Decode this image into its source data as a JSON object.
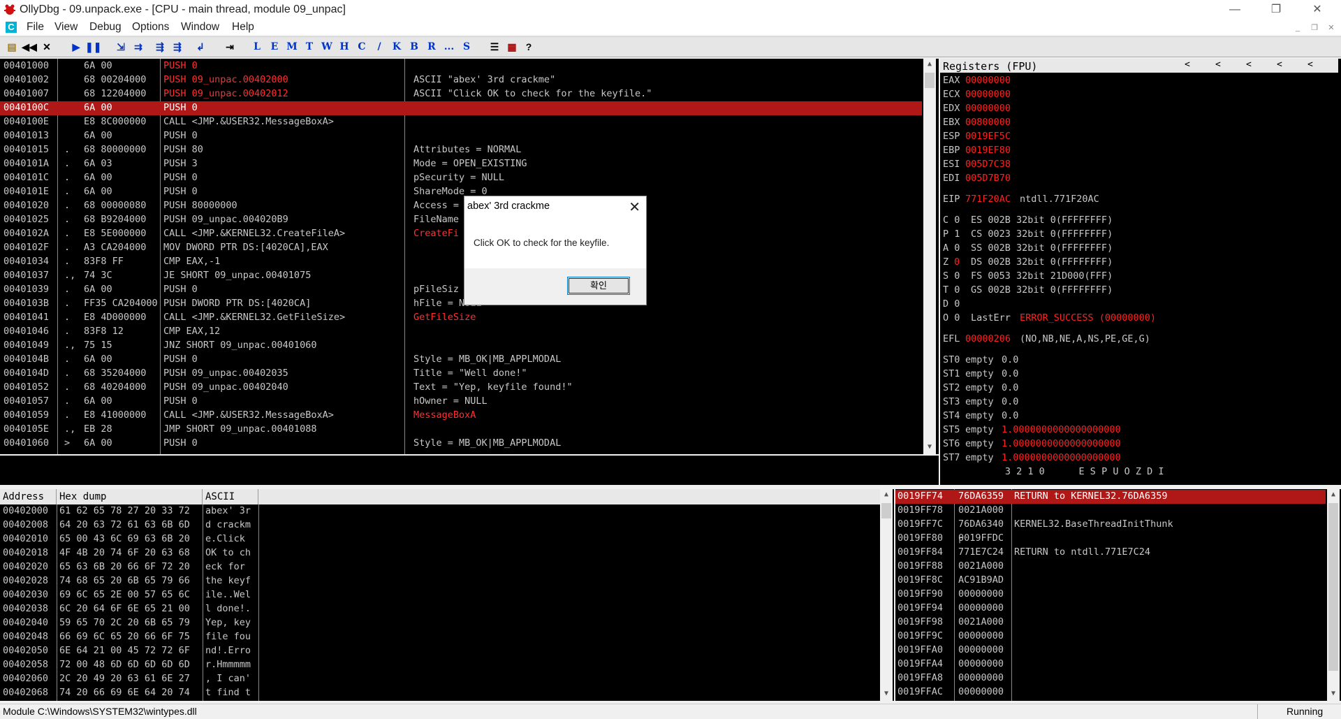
{
  "window": {
    "title": "OllyDbg - 09.unpack.exe - [CPU - main thread, module 09_unpac]",
    "minimize": "—",
    "restore": "❐",
    "close": "✕"
  },
  "menu": [
    "File",
    "View",
    "Debug",
    "Options",
    "Window",
    "Help"
  ],
  "toolbar": {
    "nav_buttons": [
      "open",
      "rewind",
      "close",
      "run",
      "pause",
      "step-into",
      "step-over",
      "trace-into",
      "trace-over",
      "execute-till-return",
      "goto"
    ],
    "letters": [
      "L",
      "E",
      "M",
      "T",
      "W",
      "H",
      "C",
      "/",
      "K",
      "B",
      "R",
      "...",
      "S"
    ],
    "extra": [
      "list",
      "grid",
      "?"
    ]
  },
  "disasm": [
    {
      "addr": "00401000",
      "mark": "",
      "hex": "6A 00",
      "instr": "PUSH 0",
      "comment": "",
      "hl": true
    },
    {
      "addr": "00401002",
      "mark": "",
      "hex": "68 00204000",
      "instr": "PUSH 09_unpac.00402000",
      "comment": "ASCII \"abex' 3rd crackme\"",
      "hl": true
    },
    {
      "addr": "00401007",
      "mark": "",
      "hex": "68 12204000",
      "instr": "PUSH 09_unpac.00402012",
      "comment": "ASCII \"Click OK to check for the keyfile.\"",
      "hl": true
    },
    {
      "addr": "0040100C",
      "mark": "",
      "hex": "6A 00",
      "instr": "PUSH 0",
      "comment": "",
      "sel": true
    },
    {
      "addr": "0040100E",
      "mark": "",
      "hex": "E8 8C000000",
      "instr": "CALL <JMP.&USER32.MessageBoxA>",
      "comment": ""
    },
    {
      "addr": "00401013",
      "mark": "",
      "hex": "6A 00",
      "instr": "PUSH 0",
      "comment": ""
    },
    {
      "addr": "00401015",
      "mark": ".",
      "hex": "68 80000000",
      "instr": "PUSH 80",
      "comment": "Attributes = NORMAL"
    },
    {
      "addr": "0040101A",
      "mark": ".",
      "hex": "6A 03",
      "instr": "PUSH 3",
      "comment": "Mode = OPEN_EXISTING"
    },
    {
      "addr": "0040101C",
      "mark": ".",
      "hex": "6A 00",
      "instr": "PUSH 0",
      "comment": "pSecurity = NULL"
    },
    {
      "addr": "0040101E",
      "mark": ".",
      "hex": "6A 00",
      "instr": "PUSH 0",
      "comment": "ShareMode = 0"
    },
    {
      "addr": "00401020",
      "mark": ".",
      "hex": "68 00000080",
      "instr": "PUSH 80000000",
      "comment": "Access = "
    },
    {
      "addr": "00401025",
      "mark": ".",
      "hex": "68 B9204000",
      "instr": "PUSH 09_unpac.004020B9",
      "comment": "FileName"
    },
    {
      "addr": "0040102A",
      "mark": ".",
      "hex": "E8 5E000000",
      "instr": "CALL <JMP.&KERNEL32.CreateFileA>",
      "comment": "CreateFi",
      "redc": true
    },
    {
      "addr": "0040102F",
      "mark": ".",
      "hex": "A3 CA204000",
      "instr": "MOV DWORD PTR DS:[4020CA],EAX",
      "comment": ""
    },
    {
      "addr": "00401034",
      "mark": ".",
      "hex": "83F8 FF",
      "instr": "CMP EAX,-1",
      "comment": ""
    },
    {
      "addr": "00401037",
      "mark": ".,",
      "hex": "74 3C",
      "instr": "JE SHORT 09_unpac.00401075",
      "comment": ""
    },
    {
      "addr": "00401039",
      "mark": ".",
      "hex": "6A 00",
      "instr": "PUSH 0",
      "comment": "pFileSiz"
    },
    {
      "addr": "0040103B",
      "mark": ".",
      "hex": "FF35 CA204000",
      "instr": "PUSH DWORD PTR DS:[4020CA]",
      "comment": "hFile = NULL"
    },
    {
      "addr": "00401041",
      "mark": ".",
      "hex": "E8 4D000000",
      "instr": "CALL <JMP.&KERNEL32.GetFileSize>",
      "comment": "GetFileSize",
      "redc": true
    },
    {
      "addr": "00401046",
      "mark": ".",
      "hex": "83F8 12",
      "instr": "CMP EAX,12",
      "comment": ""
    },
    {
      "addr": "00401049",
      "mark": ".,",
      "hex": "75 15",
      "instr": "JNZ SHORT 09_unpac.00401060",
      "comment": ""
    },
    {
      "addr": "0040104B",
      "mark": ".",
      "hex": "6A 00",
      "instr": "PUSH 0",
      "comment": "Style = MB_OK|MB_APPLMODAL"
    },
    {
      "addr": "0040104D",
      "mark": ".",
      "hex": "68 35204000",
      "instr": "PUSH 09_unpac.00402035",
      "comment": "Title = \"Well done!\""
    },
    {
      "addr": "00401052",
      "mark": ".",
      "hex": "68 40204000",
      "instr": "PUSH 09_unpac.00402040",
      "comment": "Text = \"Yep, keyfile found!\""
    },
    {
      "addr": "00401057",
      "mark": ".",
      "hex": "6A 00",
      "instr": "PUSH 0",
      "comment": "hOwner = NULL"
    },
    {
      "addr": "00401059",
      "mark": ".",
      "hex": "E8 41000000",
      "instr": "CALL <JMP.&USER32.MessageBoxA>",
      "comment": "MessageBoxA",
      "redc": true
    },
    {
      "addr": "0040105E",
      "mark": ".,",
      "hex": "EB 28",
      "instr": "JMP SHORT 09_unpac.00401088",
      "comment": ""
    },
    {
      "addr": "00401060",
      "mark": ">",
      "hex": "6A 00",
      "instr": "PUSH 0",
      "comment": "Style = MB_OK|MB_APPLMODAL"
    }
  ],
  "registers": {
    "title": "Registers (FPU)",
    "gp": [
      {
        "name": "EAX",
        "val": "00000000"
      },
      {
        "name": "ECX",
        "val": "00000000"
      },
      {
        "name": "EDX",
        "val": "00000000"
      },
      {
        "name": "EBX",
        "val": "00800000"
      },
      {
        "name": "ESP",
        "val": "0019EF5C"
      },
      {
        "name": "EBP",
        "val": "0019EF80"
      },
      {
        "name": "ESI",
        "val": "005D7C38"
      },
      {
        "name": "EDI",
        "val": "005D7B70"
      }
    ],
    "eip": {
      "name": "EIP",
      "val": "771F20AC",
      "desc": "ntdll.771F20AC"
    },
    "flags": [
      {
        "f": "C 0",
        "seg": "ES 002B 32bit 0(FFFFFFFF)"
      },
      {
        "f": "P 1",
        "seg": "CS 0023 32bit 0(FFFFFFFF)"
      },
      {
        "f": "A 0",
        "seg": "SS 002B 32bit 0(FFFFFFFF)"
      },
      {
        "f": "Z",
        "fv": "0",
        "seg": "DS 002B 32bit 0(FFFFFFFF)"
      },
      {
        "f": "S 0",
        "seg": "FS 0053 32bit 21D000(FFF)"
      },
      {
        "f": "T 0",
        "seg": "GS 002B 32bit 0(FFFFFFFF)"
      },
      {
        "f": "D 0",
        "seg": ""
      }
    ],
    "lasterr": {
      "f": "O 0",
      "label": "LastErr",
      "val": "ERROR_SUCCESS (00000000)"
    },
    "efl": {
      "name": "EFL",
      "val": "00000206",
      "desc": "(NO,NB,NE,A,NS,PE,GE,G)"
    },
    "fpu": [
      {
        "name": "ST0",
        "state": "empty",
        "val": "0.0",
        "red": false
      },
      {
        "name": "ST1",
        "state": "empty",
        "val": "0.0",
        "red": false
      },
      {
        "name": "ST2",
        "state": "empty",
        "val": "0.0",
        "red": false
      },
      {
        "name": "ST3",
        "state": "empty",
        "val": "0.0",
        "red": false
      },
      {
        "name": "ST4",
        "state": "empty",
        "val": "0.0",
        "red": false
      },
      {
        "name": "ST5",
        "state": "empty",
        "val": "1.0000000000000000000",
        "red": true
      },
      {
        "name": "ST6",
        "state": "empty",
        "val": "1.0000000000000000000",
        "red": true
      },
      {
        "name": "ST7",
        "state": "empty",
        "val": "1.0000000000000000000",
        "red": true
      }
    ],
    "fpu_footer": "       3 2 1 0      E S P U O Z D I"
  },
  "dump": {
    "headers": [
      "Address",
      "Hex dump",
      "ASCII"
    ],
    "rows": [
      {
        "addr": "00402000",
        "hex": "61 62 65 78 27 20 33 72",
        "ascii": "abex' 3r"
      },
      {
        "addr": "00402008",
        "hex": "64 20 63 72 61 63 6B 6D",
        "ascii": "d crackm"
      },
      {
        "addr": "00402010",
        "hex": "65 00 43 6C 69 63 6B 20",
        "ascii": "e.Click "
      },
      {
        "addr": "00402018",
        "hex": "4F 4B 20 74 6F 20 63 68",
        "ascii": "OK to ch"
      },
      {
        "addr": "00402020",
        "hex": "65 63 6B 20 66 6F 72 20",
        "ascii": "eck for "
      },
      {
        "addr": "00402028",
        "hex": "74 68 65 20 6B 65 79 66",
        "ascii": "the keyf"
      },
      {
        "addr": "00402030",
        "hex": "69 6C 65 2E 00 57 65 6C",
        "ascii": "ile..Wel"
      },
      {
        "addr": "00402038",
        "hex": "6C 20 64 6F 6E 65 21 00",
        "ascii": "l done!."
      },
      {
        "addr": "00402040",
        "hex": "59 65 70 2C 20 6B 65 79",
        "ascii": "Yep, key"
      },
      {
        "addr": "00402048",
        "hex": "66 69 6C 65 20 66 6F 75",
        "ascii": "file fou"
      },
      {
        "addr": "00402050",
        "hex": "6E 64 21 00 45 72 72 6F",
        "ascii": "nd!.Erro"
      },
      {
        "addr": "00402058",
        "hex": "72 00 48 6D 6D 6D 6D 6D",
        "ascii": "r.Hmmmmm"
      },
      {
        "addr": "00402060",
        "hex": "2C 20 49 20 63 61 6E 27",
        "ascii": ", I can'"
      },
      {
        "addr": "00402068",
        "hex": "74 20 66 69 6E 64 20 74",
        "ascii": "t find t"
      }
    ]
  },
  "stack": [
    {
      "addr": "0019FF74",
      "val": "76DA6359",
      "comment": "RETURN to KERNEL32.76DA6359",
      "sel": true
    },
    {
      "addr": "0019FF78",
      "val": "0021A000",
      "comment": ""
    },
    {
      "addr": "0019FF7C",
      "val": "76DA6340",
      "comment": "KERNEL32.BaseThreadInitThunk"
    },
    {
      "addr": "0019FF80",
      "val": "0019FFDC",
      "comment": "",
      "bracket": true
    },
    {
      "addr": "0019FF84",
      "val": "771E7C24",
      "comment": "RETURN to ntdll.771E7C24"
    },
    {
      "addr": "0019FF88",
      "val": "0021A000",
      "comment": ""
    },
    {
      "addr": "0019FF8C",
      "val": "AC91B9AD",
      "comment": ""
    },
    {
      "addr": "0019FF90",
      "val": "00000000",
      "comment": ""
    },
    {
      "addr": "0019FF94",
      "val": "00000000",
      "comment": ""
    },
    {
      "addr": "0019FF98",
      "val": "0021A000",
      "comment": ""
    },
    {
      "addr": "0019FF9C",
      "val": "00000000",
      "comment": ""
    },
    {
      "addr": "0019FFA0",
      "val": "00000000",
      "comment": ""
    },
    {
      "addr": "0019FFA4",
      "val": "00000000",
      "comment": ""
    },
    {
      "addr": "0019FFA8",
      "val": "00000000",
      "comment": ""
    },
    {
      "addr": "0019FFAC",
      "val": "00000000",
      "comment": ""
    }
  ],
  "dialog": {
    "title": "abex' 3rd crackme",
    "message": "Click OK to check for the keyfile.",
    "ok": "확인",
    "close": "✕"
  },
  "status": {
    "text": "Module C:\\Windows\\SYSTEM32\\wintypes.dll",
    "state": "Running"
  },
  "colors": {
    "accent_red": "#ff2020",
    "selection": "#b01818",
    "pane_bg": "#000000"
  }
}
